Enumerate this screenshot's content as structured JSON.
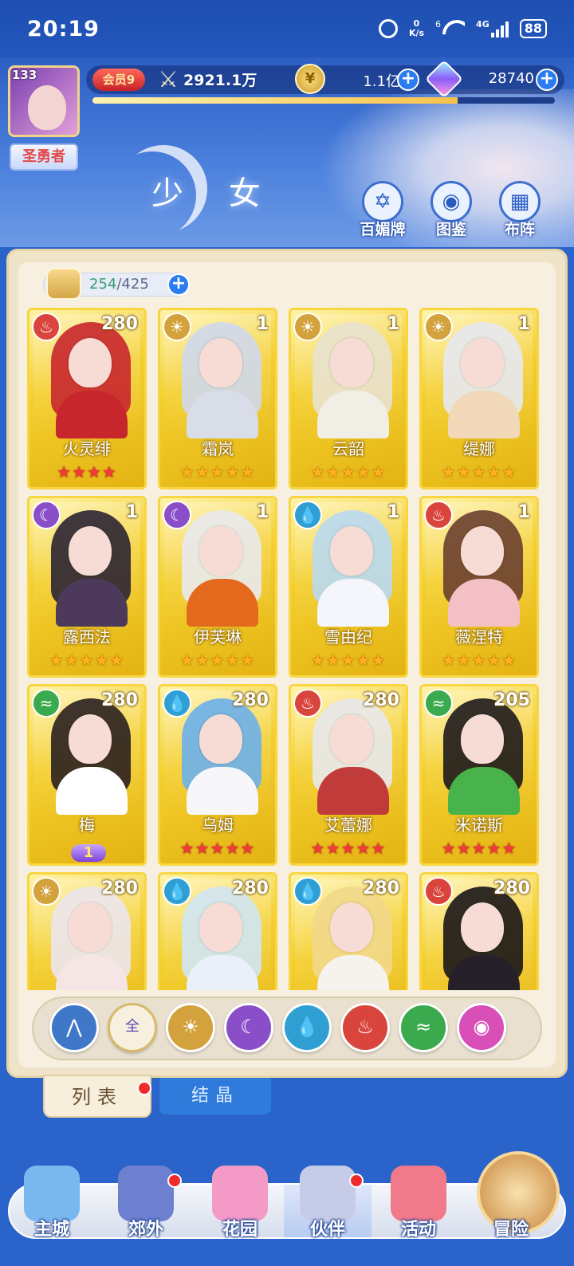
{
  "status_bar": {
    "time": "20:19",
    "net_speed_value": "0",
    "net_speed_unit": "K/s",
    "wifi_badge": "6",
    "network": "4G",
    "battery": "88"
  },
  "header": {
    "player_level": "133",
    "rank_title": "圣勇者",
    "vip_label": "会员9",
    "combat_power": "2921.1万",
    "gold": "1.1亿",
    "gems": "28740",
    "xp_progress": 0.79,
    "page_title": "少 女",
    "buttons": [
      {
        "label": "百媚牌",
        "icon": "card-deck-icon"
      },
      {
        "label": "图鉴",
        "icon": "book-icon"
      },
      {
        "label": "布阵",
        "icon": "formation-grid-icon"
      }
    ]
  },
  "capacity": {
    "used": "254",
    "total": "/425"
  },
  "cards": [
    {
      "name": "火灵绯",
      "level": "280",
      "element": "fire",
      "stars": 4,
      "star_color": "red"
    },
    {
      "name": "霜岚",
      "level": "1",
      "element": "light",
      "stars": 5,
      "star_color": "gold"
    },
    {
      "name": "云韶",
      "level": "1",
      "element": "light",
      "stars": 5,
      "star_color": "gold"
    },
    {
      "name": "缇娜",
      "level": "1",
      "element": "light",
      "stars": 5,
      "star_color": "gold"
    },
    {
      "name": "露西法",
      "level": "1",
      "element": "moon",
      "stars": 5,
      "star_color": "gold"
    },
    {
      "name": "伊芙琳",
      "level": "1",
      "element": "moon",
      "stars": 5,
      "star_color": "gold"
    },
    {
      "name": "雪由纪",
      "level": "1",
      "element": "water",
      "stars": 5,
      "star_color": "gold"
    },
    {
      "name": "薇涅特",
      "level": "1",
      "element": "fire",
      "stars": 5,
      "star_color": "gold"
    },
    {
      "name": "梅",
      "level": "280",
      "element": "wind",
      "stars": 0,
      "star_color": "red",
      "awaken": "1"
    },
    {
      "name": "乌姆",
      "level": "280",
      "element": "water",
      "stars": 5,
      "star_color": "red"
    },
    {
      "name": "艾蕾娜",
      "level": "280",
      "element": "fire",
      "stars": 5,
      "star_color": "red"
    },
    {
      "name": "米诺斯",
      "level": "205",
      "element": "wind",
      "stars": 5,
      "star_color": "red"
    },
    {
      "name": "",
      "level": "280",
      "element": "light",
      "stars": 0,
      "star_color": "red"
    },
    {
      "name": "",
      "level": "280",
      "element": "water",
      "stars": 0,
      "star_color": "red"
    },
    {
      "name": "",
      "level": "280",
      "element": "water",
      "stars": 0,
      "star_color": "red"
    },
    {
      "name": "",
      "level": "280",
      "element": "fire",
      "stars": 0,
      "star_color": "red"
    }
  ],
  "filters": [
    {
      "name": "filter-back-icon",
      "glyph": "⋀",
      "color": "#3f78c9"
    },
    {
      "name": "filter-all-button",
      "glyph": "全",
      "color": "#f7f0de"
    },
    {
      "name": "filter-light-icon",
      "glyph": "☀",
      "color": "#d3a23c"
    },
    {
      "name": "filter-moon-icon",
      "glyph": "☾",
      "color": "#8a4ec9"
    },
    {
      "name": "filter-water-icon",
      "glyph": "💧",
      "color": "#2f9fd3"
    },
    {
      "name": "filter-fire-icon",
      "glyph": "♨",
      "color": "#d9443c"
    },
    {
      "name": "filter-wind-icon",
      "glyph": "≈",
      "color": "#3ba94d"
    },
    {
      "name": "filter-dark-icon",
      "glyph": "◉",
      "color": "#d94fb8"
    }
  ],
  "tabs": {
    "list": "列表",
    "crystal": "结晶"
  },
  "nav": [
    {
      "label": "主城",
      "color": "#79b8ef",
      "badge": false
    },
    {
      "label": "郊外",
      "color": "#6d7fcf",
      "badge": true
    },
    {
      "label": "花园",
      "color": "#f49ac6",
      "badge": false
    },
    {
      "label": "伙伴",
      "color": "#c6cbe8",
      "badge": true
    },
    {
      "label": "活动",
      "color": "#f07a8a",
      "badge": false
    },
    {
      "label": "冒险",
      "color": "#d99a45",
      "badge": false
    }
  ]
}
